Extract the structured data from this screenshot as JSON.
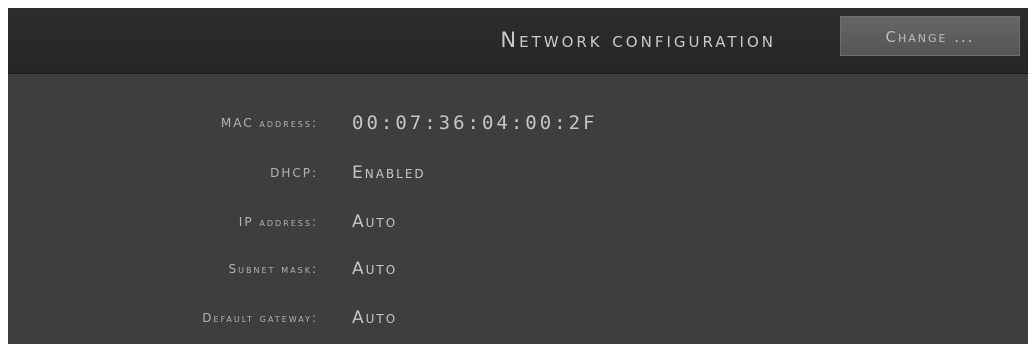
{
  "header": {
    "title": "Network configuration",
    "change_button": "Change ..."
  },
  "fields": [
    {
      "label": "MAC address:",
      "value": "00:07:36:04:00:2F"
    },
    {
      "label": "DHCP:",
      "value": "Enabled"
    },
    {
      "label": "IP address:",
      "value": "Auto"
    },
    {
      "label": "Subnet mask:",
      "value": "Auto"
    },
    {
      "label": "Default gateway:",
      "value": "Auto"
    }
  ],
  "colors": {
    "panel_background": "#3e3e3e",
    "header_background": "#2a2a2a",
    "button_background": "#5e5e5e",
    "text": "#c6c6c6"
  }
}
